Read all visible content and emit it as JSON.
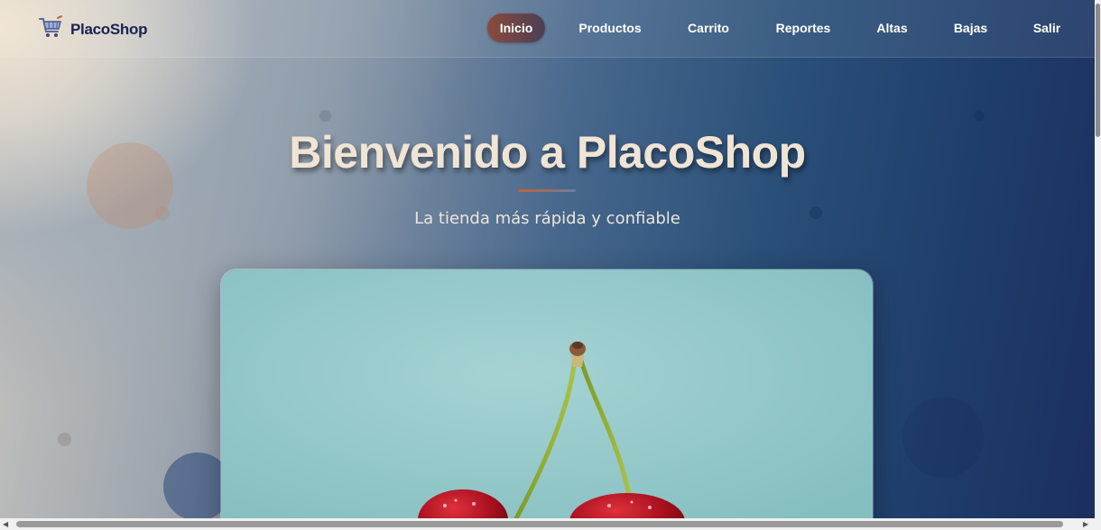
{
  "brand": {
    "name": "PlacoShop",
    "icon": "shopping-cart-icon"
  },
  "nav": {
    "items": [
      {
        "label": "Inicio",
        "active": true
      },
      {
        "label": "Productos",
        "active": false
      },
      {
        "label": "Carrito",
        "active": false
      },
      {
        "label": "Reportes",
        "active": false
      },
      {
        "label": "Altas",
        "active": false
      },
      {
        "label": "Bajas",
        "active": false
      },
      {
        "label": "Salir",
        "active": false
      }
    ]
  },
  "hero": {
    "title": "Bienvenido a PlacoShop",
    "subtitle": "La tienda más rápida y confiable",
    "image": "cherries-photo"
  },
  "colors": {
    "accent": "#8c4a3c",
    "brand_text": "#1a2250",
    "title": "#f0e4d4",
    "image_bg": "#8fc3c4"
  }
}
